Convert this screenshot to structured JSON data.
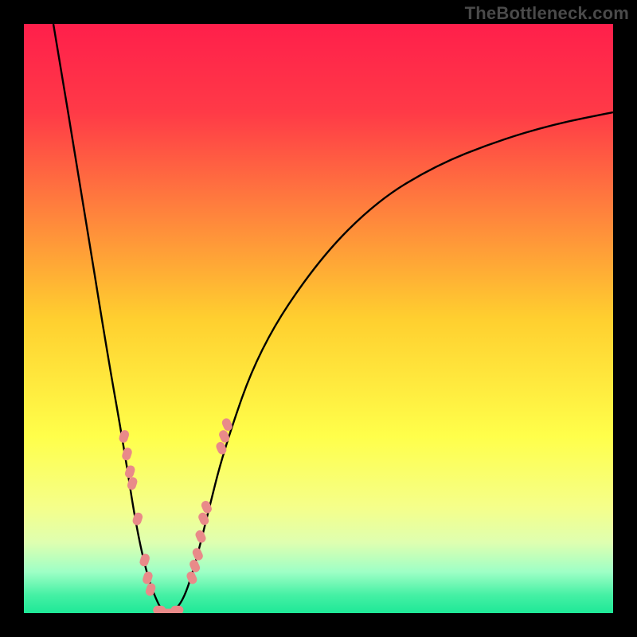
{
  "watermark": "TheBottleneck.com",
  "chart_data": {
    "type": "line",
    "title": "",
    "xlabel": "",
    "ylabel": "",
    "xlim": [
      0,
      100
    ],
    "ylim": [
      0,
      100
    ],
    "grid": false,
    "legend": false,
    "curve": {
      "note": "V-shaped bottleneck curve; minimum (optimal) near x≈24; curve rises steeply left of minimum to full height and rises asymptotically right of minimum.",
      "points": [
        {
          "x": 5,
          "y": 100
        },
        {
          "x": 10,
          "y": 70
        },
        {
          "x": 14,
          "y": 45
        },
        {
          "x": 17,
          "y": 28
        },
        {
          "x": 19,
          "y": 15
        },
        {
          "x": 21,
          "y": 6
        },
        {
          "x": 23,
          "y": 1
        },
        {
          "x": 24,
          "y": 0
        },
        {
          "x": 25,
          "y": 0
        },
        {
          "x": 27,
          "y": 2
        },
        {
          "x": 29,
          "y": 8
        },
        {
          "x": 31,
          "y": 16
        },
        {
          "x": 34,
          "y": 28
        },
        {
          "x": 40,
          "y": 45
        },
        {
          "x": 50,
          "y": 60
        },
        {
          "x": 60,
          "y": 70
        },
        {
          "x": 70,
          "y": 76
        },
        {
          "x": 80,
          "y": 80
        },
        {
          "x": 90,
          "y": 83
        },
        {
          "x": 100,
          "y": 85
        }
      ]
    },
    "marker_clusters": {
      "color": "#e98a89",
      "left_branch": [
        {
          "x": 17.0,
          "y": 30
        },
        {
          "x": 17.5,
          "y": 27
        },
        {
          "x": 18.0,
          "y": 24
        },
        {
          "x": 18.4,
          "y": 22
        },
        {
          "x": 19.3,
          "y": 16
        },
        {
          "x": 20.5,
          "y": 9
        },
        {
          "x": 21.0,
          "y": 6
        },
        {
          "x": 21.5,
          "y": 4
        }
      ],
      "trough": [
        {
          "x": 23.0,
          "y": 0.5
        },
        {
          "x": 24.0,
          "y": 0
        },
        {
          "x": 25.0,
          "y": 0
        },
        {
          "x": 26.0,
          "y": 0.5
        }
      ],
      "right_branch": [
        {
          "x": 28.5,
          "y": 6
        },
        {
          "x": 29.0,
          "y": 8
        },
        {
          "x": 29.5,
          "y": 10
        },
        {
          "x": 30.0,
          "y": 13
        },
        {
          "x": 30.5,
          "y": 16
        },
        {
          "x": 31.0,
          "y": 18
        },
        {
          "x": 33.5,
          "y": 28
        },
        {
          "x": 34.0,
          "y": 30
        },
        {
          "x": 34.5,
          "y": 32
        }
      ]
    },
    "gradient_stops": [
      {
        "pos": 0.0,
        "color": "#ff1f4b"
      },
      {
        "pos": 0.15,
        "color": "#ff3a47"
      },
      {
        "pos": 0.3,
        "color": "#ff7a3e"
      },
      {
        "pos": 0.5,
        "color": "#ffcf2f"
      },
      {
        "pos": 0.7,
        "color": "#ffff4a"
      },
      {
        "pos": 0.82,
        "color": "#f5ff8a"
      },
      {
        "pos": 0.88,
        "color": "#dfffb0"
      },
      {
        "pos": 0.93,
        "color": "#9effc6"
      },
      {
        "pos": 0.97,
        "color": "#44f0a4"
      },
      {
        "pos": 1.0,
        "color": "#1ee897"
      }
    ]
  }
}
